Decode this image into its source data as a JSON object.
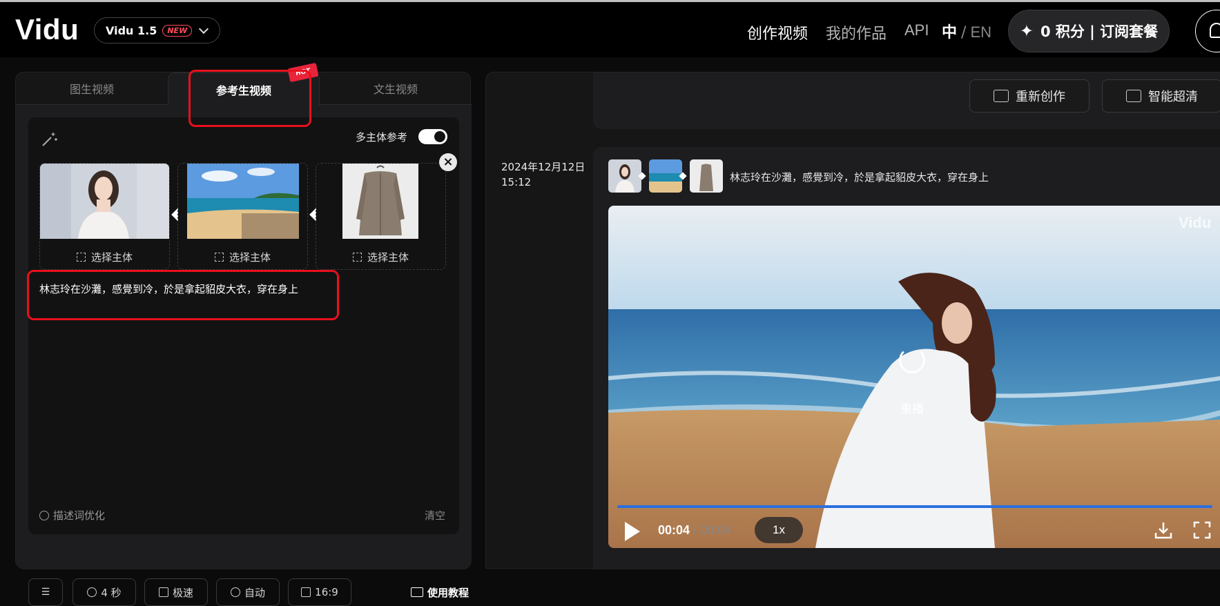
{
  "header": {
    "logo": "Vidu",
    "version": "Vidu 1.5",
    "new_badge": "NEW",
    "nav": {
      "create": "创作视频",
      "works": "我的作品",
      "api": "API"
    },
    "lang": {
      "zh": "中",
      "sep": "/",
      "en": "EN"
    },
    "credits": "0 积分 | 订阅套餐"
  },
  "left": {
    "tabs": [
      "图生视频",
      "参考生视频",
      "文生视频"
    ],
    "hot_badge": "HOT",
    "multi_subject_label": "多主体参考",
    "multi_subject_enabled": true,
    "refs": [
      {
        "action": "选择主体"
      },
      {
        "action": "选择主体"
      },
      {
        "action": "选择主体"
      }
    ],
    "close_glyph": "×",
    "prompt": "林志玲在沙灘，感覺到冷，於是拿起貂皮大衣，穿在身上",
    "optimize": "描述词优化",
    "clear": "清空",
    "options": {
      "duration": "4 秒",
      "speed": "极速",
      "motion": "自动",
      "ratio": "16:9"
    },
    "tutorial": "使用教程"
  },
  "right": {
    "toolbar": {
      "recreate": "重新创作",
      "upscale": "智能超清"
    },
    "date": "2024年12月12日",
    "time": "15:12",
    "prompt": "林志玲在沙灘，感覺到冷，於是拿起貂皮大衣，穿在身上",
    "video": {
      "watermark": "Vidu",
      "replay": "重播",
      "current": "00:04",
      "separator": "/",
      "total": "00:04",
      "speed": "1x",
      "progress": 1.0
    }
  },
  "colors": {
    "accent": "#2b6fe0",
    "highlight": "#e8101c",
    "new_badge": "#ff4d5a"
  }
}
